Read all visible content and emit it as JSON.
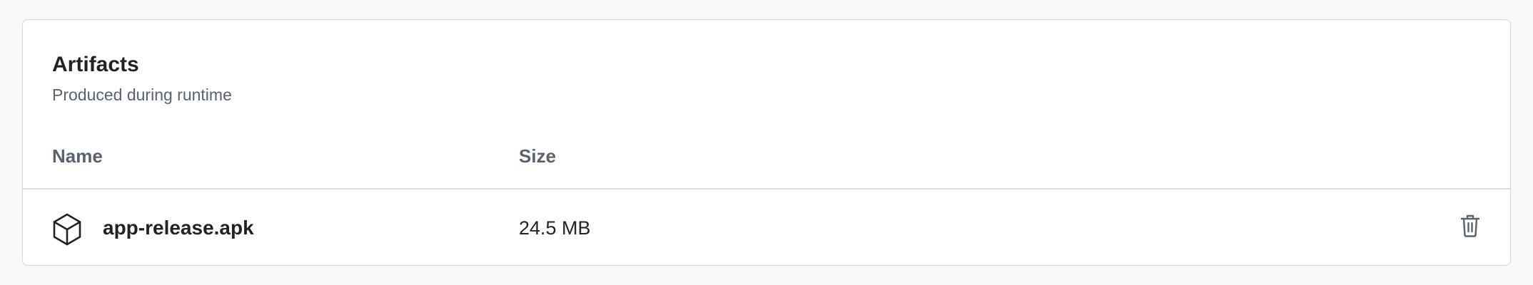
{
  "artifacts": {
    "title": "Artifacts",
    "subtitle": "Produced during runtime",
    "columns": {
      "name": "Name",
      "size": "Size"
    },
    "items": [
      {
        "icon": "package-icon",
        "name": "app-release.apk",
        "size": "24.5 MB",
        "action_icon": "trash-icon"
      }
    ]
  },
  "colors": {
    "page_background": "#f6f8fa",
    "card_background": "#ffffff",
    "border": "#d0d7de",
    "text_primary": "#1f2328",
    "text_muted": "#59636e"
  }
}
